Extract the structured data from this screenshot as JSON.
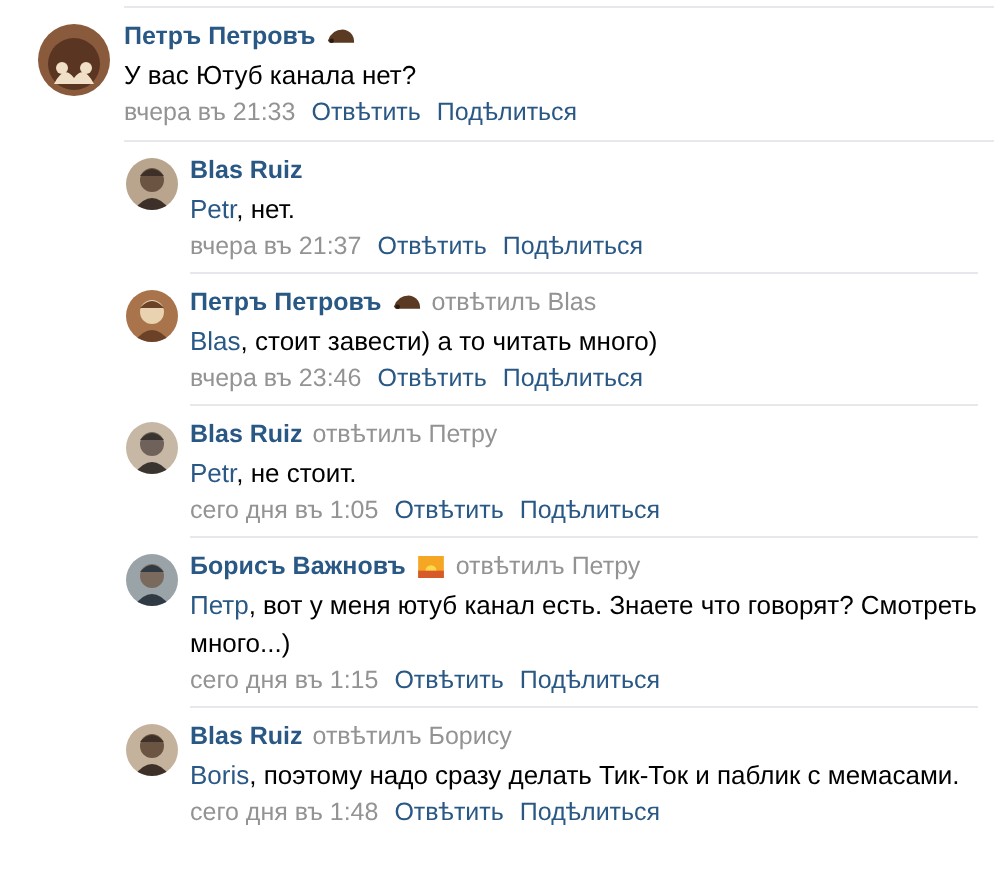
{
  "comment": {
    "author": "Петръ Петровъ",
    "emoji": {
      "kind": "hedgehog"
    },
    "text": "У вас Ютуб канала нет?",
    "time": "вчера въ 21:33",
    "actions": [
      "Отвѣтить",
      "Подѣлиться"
    ]
  },
  "replies": [
    {
      "author": "Blas Ruiz",
      "mention": "Petr",
      "text": ", нет.",
      "time": "вчера въ 21:37",
      "actions": [
        "Отвѣтить",
        "Подѣлиться"
      ]
    },
    {
      "author": "Петръ Петровъ",
      "emoji": {
        "kind": "hedgehog"
      },
      "reply_to": "отвѣтилъ Blas",
      "mention": "Blas",
      "text": ", стоит завести) а то читать много)",
      "time": "вчера въ 23:46",
      "actions": [
        "Отвѣтить",
        "Подѣлиться"
      ]
    },
    {
      "author": "Blas Ruiz",
      "reply_to": "отвѣтилъ Петру",
      "mention": "Petr",
      "text": ", не стоит.",
      "time": "сего дня въ 1:05",
      "actions": [
        "Отвѣтить",
        "Подѣлиться"
      ]
    },
    {
      "author": "Борисъ Важновъ",
      "emoji": {
        "kind": "sunset"
      },
      "reply_to": "отвѣтилъ Петру",
      "mention": "Петр",
      "text": ", вот у меня ютуб канал есть. Знаете что говорят? Смотреть много...)",
      "time": "сего дня въ 1:15",
      "actions": [
        "Отвѣтить",
        "Подѣлиться"
      ]
    },
    {
      "author": "Blas Ruiz",
      "reply_to": "отвѣтилъ Борису",
      "mention": "Boris",
      "text": ", поэтому надо сразу делать Тик-Ток и паблик с мемасами.",
      "time": "сего дня въ 1:48",
      "actions": [
        "Отвѣтить",
        "Подѣлиться"
      ]
    }
  ]
}
